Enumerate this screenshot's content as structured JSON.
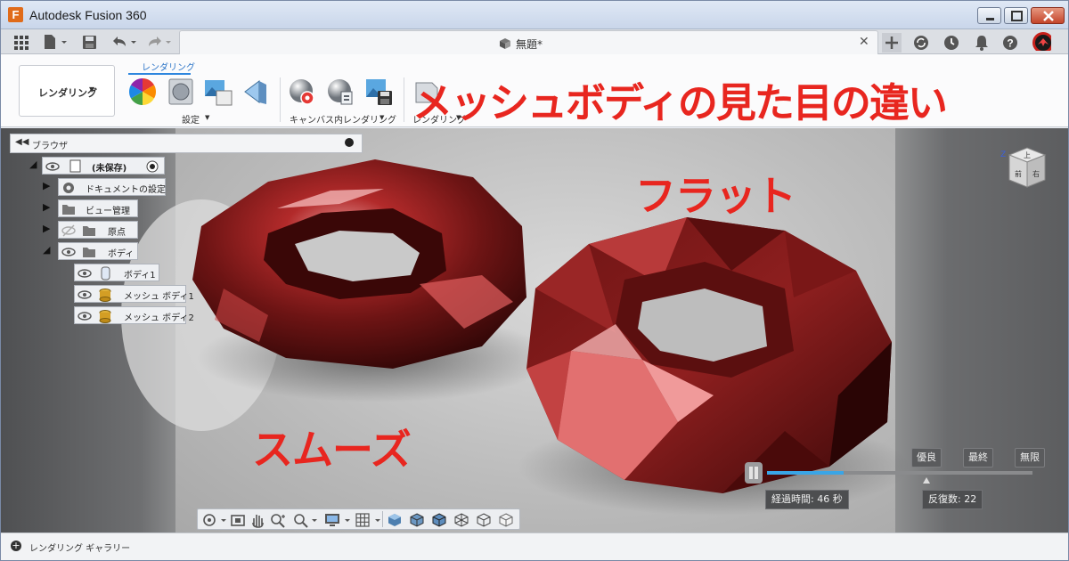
{
  "window": {
    "app_title": "Autodesk Fusion 360",
    "logo_letter": "F",
    "accent": "#e06b1a"
  },
  "tabbar": {
    "document_tab_label": "無題*",
    "icons": [
      "grid-icon",
      "file-icon",
      "save-icon",
      "undo-icon",
      "redo-icon",
      "new-tab-icon",
      "sync-icon",
      "history-icon",
      "bell-icon",
      "help-icon",
      "avatar"
    ]
  },
  "toolbar": {
    "workspace_label": "レンダリング",
    "active_tab_label": "レンダリング",
    "groups": [
      {
        "label": "設定",
        "icons": [
          "appearance-icon",
          "scene-settings-icon",
          "texture-map-icon",
          "decal-icon"
        ]
      },
      {
        "label": "キャンバス内レンダリング",
        "icons": [
          "in-canvas-render-icon",
          "render-settings-icon",
          "capture-image-icon"
        ]
      },
      {
        "label": "レンダリング",
        "icons": [
          "render-icon"
        ]
      }
    ]
  },
  "overlay": {
    "title": "メッシュボディの見た目の違い",
    "label_smooth": "スムーズ",
    "label_flat": "フラット",
    "color": "#e8261f"
  },
  "browser": {
    "title": "ブラウザ",
    "root_label": "(未保存)",
    "nodes": [
      {
        "label": "ドキュメントの設定",
        "icon": "gear-icon"
      },
      {
        "label": "ビュー管理",
        "icon": "folder-icon"
      },
      {
        "label": "原点",
        "icon": "folder-icon"
      },
      {
        "label": "ボディ",
        "icon": "folder-icon"
      },
      {
        "label": "ボディ1",
        "icon": "body-icon"
      },
      {
        "label": "メッシュ ボディ1",
        "icon": "mesh-body-icon"
      },
      {
        "label": "メッシュ ボディ2",
        "icon": "mesh-body-icon"
      }
    ]
  },
  "viewcube": {
    "face_top": "上",
    "face_front": "前",
    "face_right": "右"
  },
  "render_progress": {
    "quality_buttons": [
      "優良",
      "最終",
      "無限"
    ],
    "elapsed": "経過時間: 46 秒",
    "iterations": "反復数: 22",
    "progress_fraction": 0.29
  },
  "statusbar": {
    "label": "レンダリング ギャラリー"
  }
}
